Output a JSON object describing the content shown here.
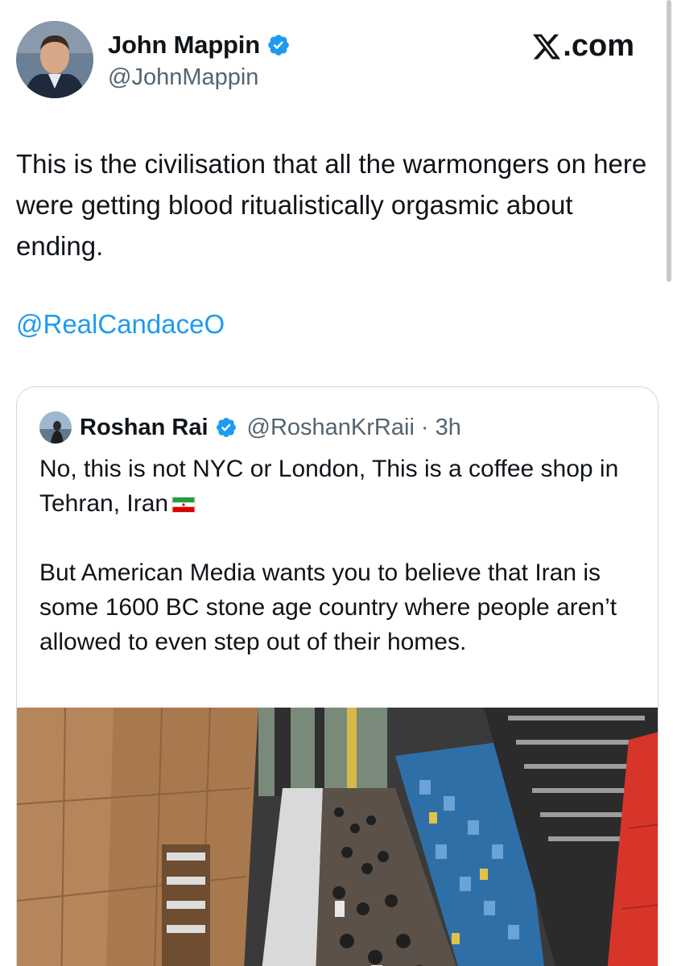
{
  "author": {
    "name": "John Mappin",
    "handle": "@JohnMappin",
    "verified": true
  },
  "site": {
    "label": ".com",
    "brand_icon": "x-logo-icon"
  },
  "tweet": {
    "text": "This is the civilisation that all the warmongers on here were getting blood ritualistically orgasmic about ending.",
    "mention": "@RealCandaceO"
  },
  "quoted": {
    "name": "Roshan Rai",
    "handle": "@RoshanKrRaii",
    "separator": "·",
    "time": "3h",
    "paragraph1": "No, this is not NYC or London, This is a coffee shop in Tehran, Iran",
    "flag_icon": "iran-flag-icon",
    "paragraph2": "But American Media wants you to believe that Iran is some 1600 BC stone age country where people aren’t allowed to even step out of their homes.",
    "media_description_icon": "coffee-shop-photo"
  },
  "colors": {
    "link": "#1d9bf0",
    "secondary_text": "#536471",
    "verified": "#1d9bf0",
    "border": "#cfd9de"
  }
}
